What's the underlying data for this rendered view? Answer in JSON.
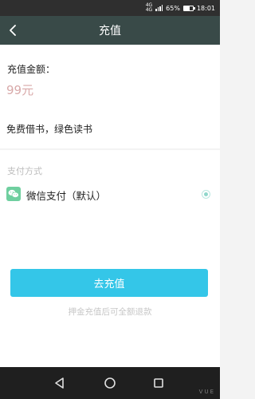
{
  "status_bar": {
    "network_top": "4G",
    "network_bottom": "4G",
    "battery_text": "65%",
    "battery_level": 0.65,
    "time": "18:01"
  },
  "header": {
    "title": "充值",
    "back_icon": "chevron-left-icon"
  },
  "amount": {
    "label": "充值金额：",
    "value": "99元"
  },
  "slogan": "免费借书，绿色读书",
  "payment": {
    "header": "支付方式",
    "option": {
      "icon": "wechat-pay-icon",
      "label": "微信支付（默认）",
      "selected": true
    }
  },
  "actions": {
    "recharge_button": "去充值"
  },
  "note": "押金充值后可全额退款",
  "nav_bar": {
    "back_icon": "triangle-back-icon",
    "home_icon": "circle-home-icon",
    "recent_icon": "square-recent-icon",
    "watermark": "VUE"
  },
  "colors": {
    "header_bg": "#394a48",
    "accent_button": "#34c6e8",
    "amount_color": "#d8a9a9",
    "radio_selected": "#8fd7cb",
    "wechat_green": "#6fcf9f"
  }
}
